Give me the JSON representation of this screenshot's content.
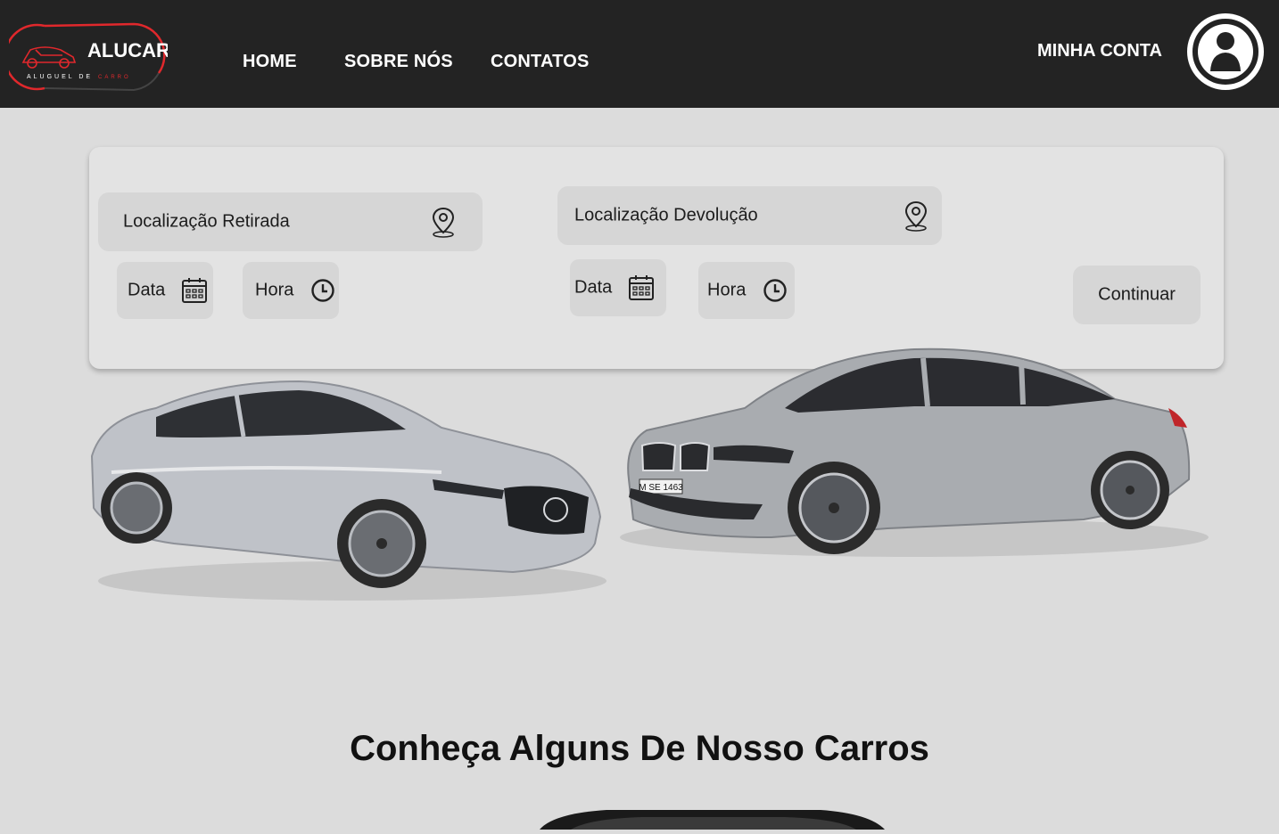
{
  "brand": {
    "name": "ALUCAR",
    "tagline_left": "ALUGUEL DE",
    "tagline_right": "CARRO",
    "accent": "#e0282c"
  },
  "nav": {
    "items": [
      {
        "label": "HOME"
      },
      {
        "label": "SOBRE NÓS"
      },
      {
        "label": "CONTATOS"
      }
    ],
    "account_label": "MINHA CONTA"
  },
  "booking": {
    "pickup": {
      "location_label": "Localização Retirada",
      "date_label": "Data",
      "time_label": "Hora"
    },
    "return": {
      "location_label": "Localização Devolução",
      "date_label": "Data",
      "time_label": "Hora"
    },
    "continue_label": "Continuar"
  },
  "cars": [
    {
      "name": "mercedes-e-class",
      "color": "#b9bcc2"
    },
    {
      "name": "bmw-3-series",
      "color": "#a8abaf",
      "plate": "M SE 1463"
    }
  ],
  "section": {
    "title": "Conheça Alguns De Nosso Carros"
  },
  "colors": {
    "header_bg": "#232323",
    "page_bg": "#dcdcdc",
    "panel_bg": "#e3e3e3",
    "field_bg": "#d6d6d6"
  }
}
